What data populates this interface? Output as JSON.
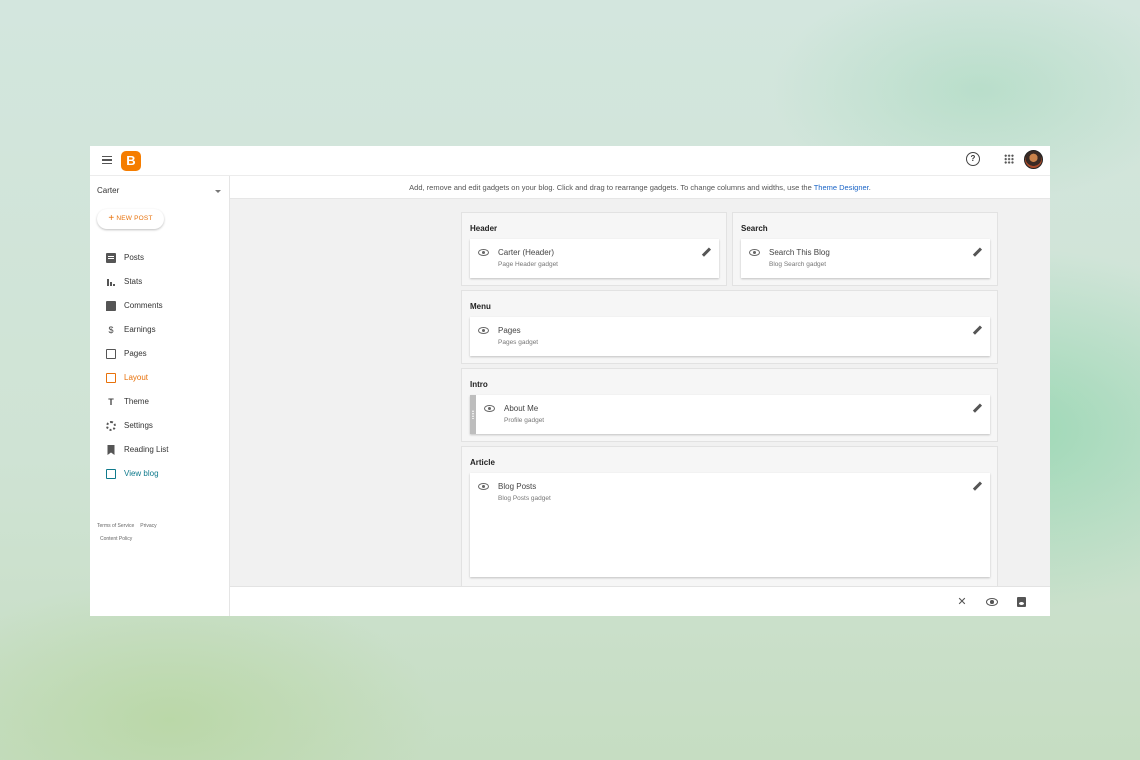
{
  "app": {
    "logo_letter": "B",
    "brand_color": "#f57d00",
    "accent_color": "#e8710a",
    "link_color": "#1a64c6"
  },
  "topbar": {
    "help_icon": "help-circle-icon",
    "help_glyph": "?",
    "apps_icon": "apps-grid-icon",
    "avatar": "user-avatar"
  },
  "sidebar": {
    "blog_name": "Carter",
    "new_post_label": "NEW POST",
    "new_post_plus": "+",
    "items": [
      {
        "label": "Posts",
        "icon": "posts-icon"
      },
      {
        "label": "Stats",
        "icon": "stats-icon"
      },
      {
        "label": "Comments",
        "icon": "comments-icon"
      },
      {
        "label": "Earnings",
        "icon": "dollar-icon",
        "glyph": "$"
      },
      {
        "label": "Pages",
        "icon": "pages-icon"
      },
      {
        "label": "Layout",
        "icon": "layout-icon",
        "active": true
      },
      {
        "label": "Theme",
        "icon": "paint-roller-icon"
      },
      {
        "label": "Settings",
        "icon": "gear-icon"
      },
      {
        "label": "Reading List",
        "icon": "bookmark-icon"
      },
      {
        "label": "View blog",
        "icon": "open-external-icon"
      }
    ],
    "footer": {
      "terms": "Terms of Service",
      "privacy": "Privacy",
      "content_policy": "Content Policy"
    }
  },
  "main": {
    "info_text": "Add, remove and edit gadgets on your blog. Click and drag to rearrange gadgets. To change columns and widths, use the ",
    "info_link": "Theme Designer",
    "info_end": ".",
    "sections": {
      "header": {
        "title": "Header",
        "gadget": {
          "name": "Carter (Header)",
          "type": "Page Header gadget"
        }
      },
      "search": {
        "title": "Search",
        "gadget": {
          "name": "Search This Blog",
          "type": "Blog Search gadget"
        }
      },
      "menu": {
        "title": "Menu",
        "gadget": {
          "name": "Pages",
          "type": "Pages gadget"
        }
      },
      "intro": {
        "title": "Intro",
        "gadget": {
          "name": "About Me",
          "type": "Profile gadget"
        }
      },
      "article": {
        "title": "Article",
        "gadget": {
          "name": "Blog Posts",
          "type": "Blog Posts gadget"
        }
      }
    }
  },
  "bottom_bar": {
    "close_glyph": "✕",
    "close_icon": "close-icon",
    "preview_icon": "preview-eye-icon",
    "save_icon": "save-icon"
  }
}
